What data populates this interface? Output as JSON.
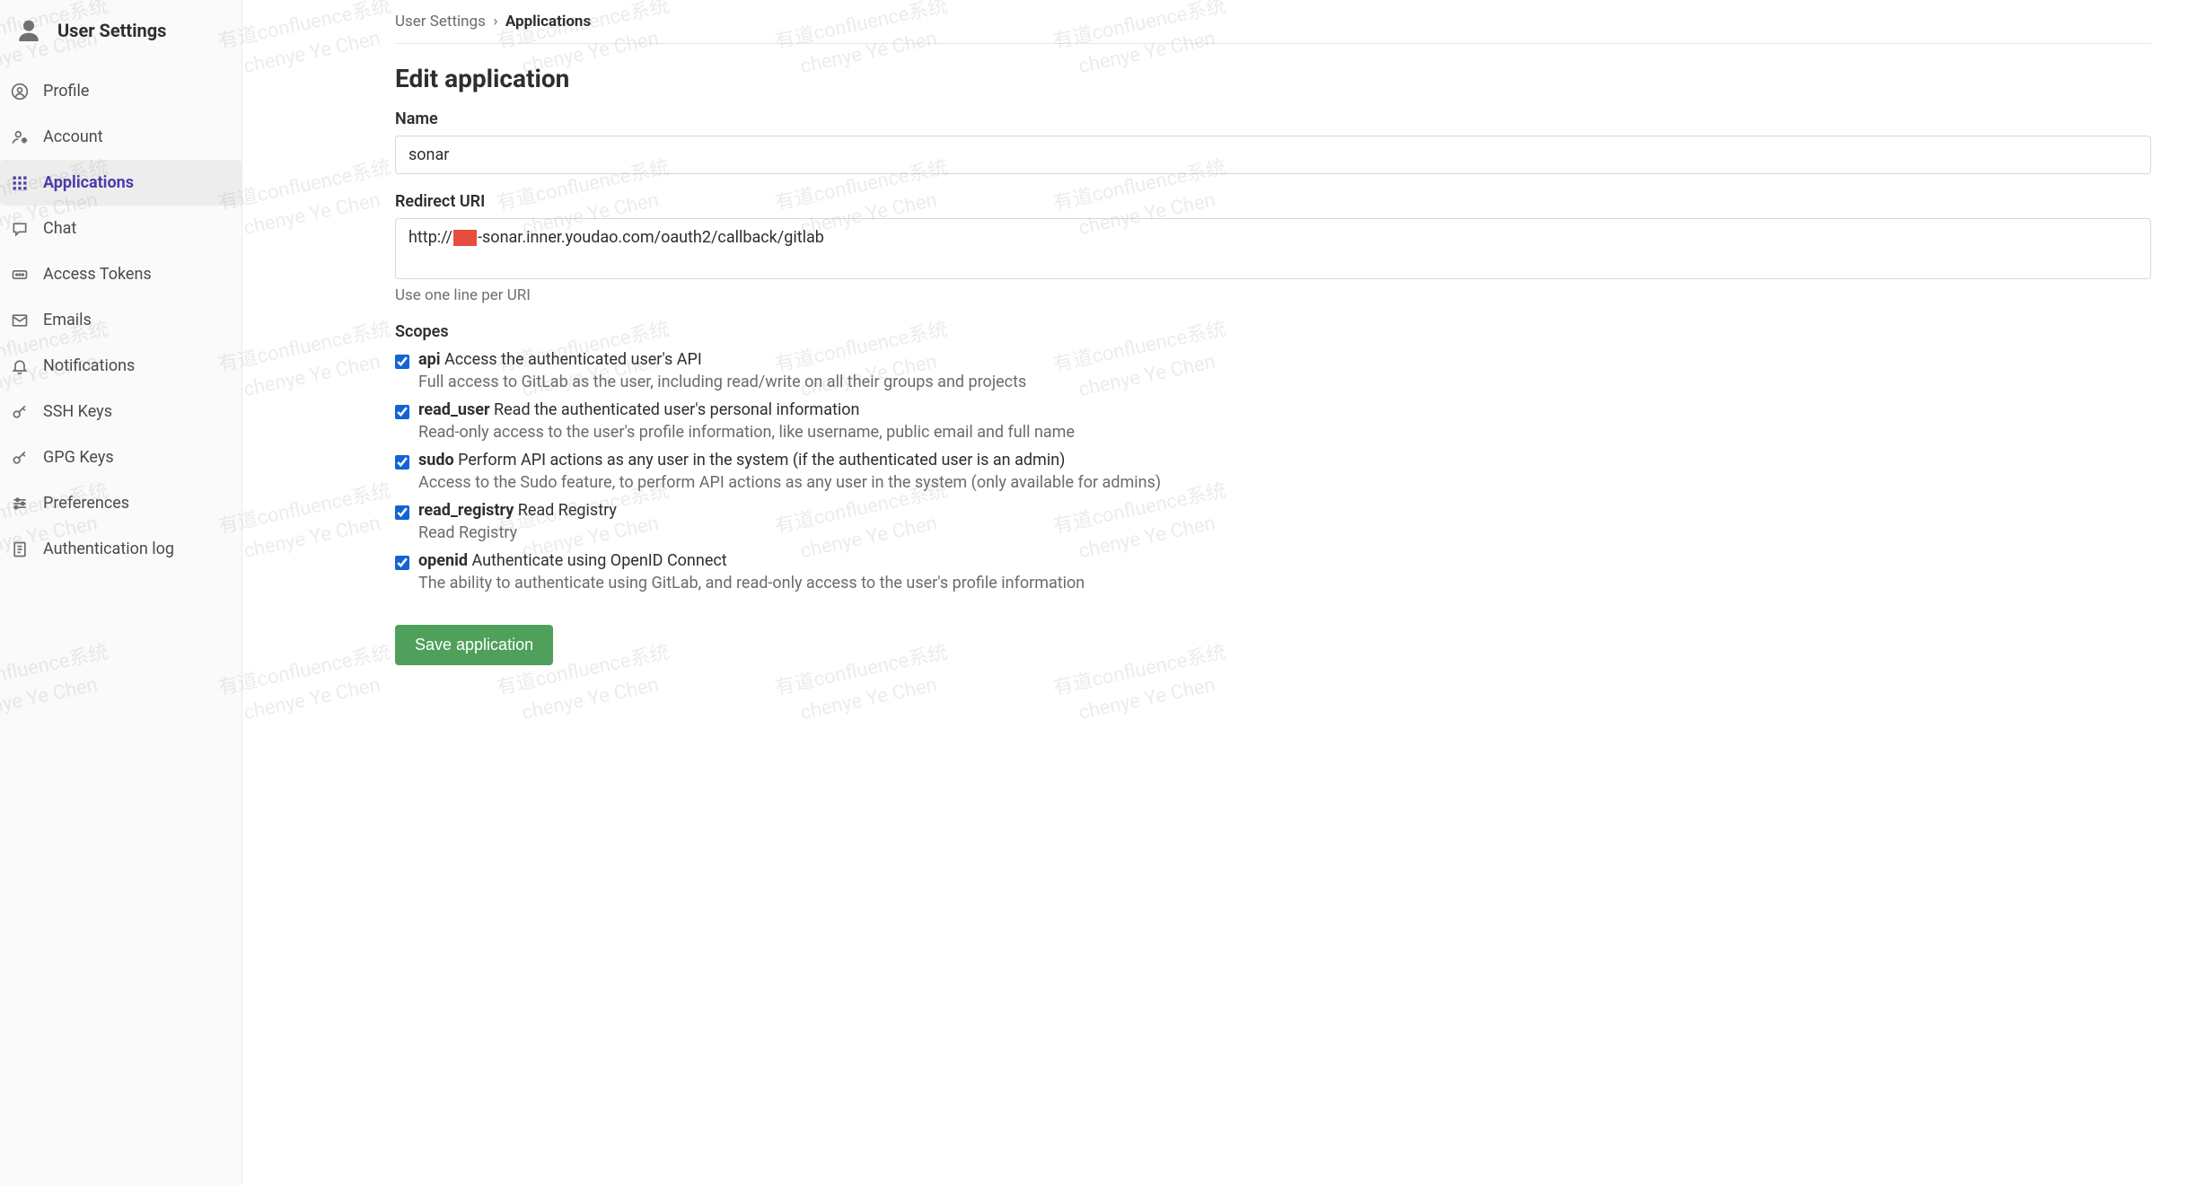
{
  "sidebar": {
    "title": "User Settings",
    "items": [
      {
        "label": "Profile"
      },
      {
        "label": "Account"
      },
      {
        "label": "Applications"
      },
      {
        "label": "Chat"
      },
      {
        "label": "Access Tokens"
      },
      {
        "label": "Emails"
      },
      {
        "label": "Notifications"
      },
      {
        "label": "SSH Keys"
      },
      {
        "label": "GPG Keys"
      },
      {
        "label": "Preferences"
      },
      {
        "label": "Authentication log"
      }
    ]
  },
  "breadcrumb": {
    "parent": "User Settings",
    "separator": "›",
    "current": "Applications"
  },
  "page": {
    "title": "Edit application"
  },
  "form": {
    "name_label": "Name",
    "name_value": "sonar",
    "redirect_label": "Redirect URI",
    "redirect_prefix": "http://",
    "redirect_suffix": "-sonar.inner.youdao.com/oauth2/callback/gitlab",
    "redirect_help": "Use one line per URI",
    "scopes_label": "Scopes",
    "save_label": "Save application"
  },
  "scopes": [
    {
      "name": "api",
      "summary": "Access the authenticated user's API",
      "desc": "Full access to GitLab as the user, including read/write on all their groups and projects",
      "checked": true
    },
    {
      "name": "read_user",
      "summary": "Read the authenticated user's personal information",
      "desc": "Read-only access to the user's profile information, like username, public email and full name",
      "checked": true
    },
    {
      "name": "sudo",
      "summary": "Perform API actions as any user in the system (if the authenticated user is an admin)",
      "desc": "Access to the Sudo feature, to perform API actions as any user in the system (only available for admins)",
      "checked": true
    },
    {
      "name": "read_registry",
      "summary": "Read Registry",
      "desc": "Read Registry",
      "checked": true
    },
    {
      "name": "openid",
      "summary": "Authenticate using OpenID Connect",
      "desc": "The ability to authenticate using GitLab, and read-only access to the user's profile information",
      "checked": true
    }
  ],
  "watermark": {
    "line1": "有道confluence系统",
    "line2": "chenye  Ye Chen"
  }
}
